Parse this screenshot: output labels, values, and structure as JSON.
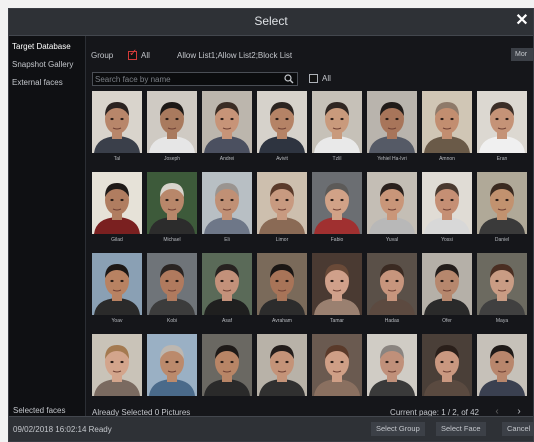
{
  "dialog": {
    "title": "Select",
    "close_label": "✕"
  },
  "sidebar": {
    "items": [
      {
        "label": "Target Database",
        "active": true
      },
      {
        "label": "Snapshot Gallery",
        "active": false
      },
      {
        "label": "External faces",
        "active": false
      }
    ],
    "bottom_label": "Selected faces"
  },
  "toolbar": {
    "group_label": "Group",
    "all_label": "All",
    "lists_label": "Allow List1;Allow List2;Block List",
    "more_label": "Mor"
  },
  "search": {
    "placeholder": "Search face by name",
    "value": "",
    "all_label": "All"
  },
  "faces": [
    {
      "name": "Tal",
      "tone": "#b8866a",
      "hair": "#2a2220",
      "bg": "#d9d4cc",
      "shirt": "#3a3f4a"
    },
    {
      "name": "Joseph",
      "tone": "#a97a5e",
      "hair": "#1c1816",
      "bg": "#cfcac3",
      "shirt": "#e6e6e6"
    },
    {
      "name": "Andrei",
      "tone": "#c79478",
      "hair": "#3a2c24",
      "bg": "#bcb6ad",
      "shirt": "#4b5060"
    },
    {
      "name": "Avivit",
      "tone": "#b58366",
      "hair": "#2b2421",
      "bg": "#d6d2cb",
      "shirt": "#2e3440"
    },
    {
      "name": "Tzlil",
      "tone": "#c99a7c",
      "hair": "#2f2622",
      "bg": "#c6c1b8",
      "shirt": "#e9e9e9"
    },
    {
      "name": "Yehiel Ha-Ivri",
      "tone": "#a8755a",
      "hair": "#201b19",
      "bg": "#b9b4ad",
      "shirt": "#555a66"
    },
    {
      "name": "Amnon",
      "tone": "#c28e70",
      "hair": "#8e7a6a",
      "bg": "#d0c6b5",
      "shirt": "#6a5a48"
    },
    {
      "name": "Eran",
      "tone": "#c59377",
      "hair": "#3b2e27",
      "bg": "#dcd8d1",
      "shirt": "#f0f0f0"
    },
    {
      "name": "Gilad",
      "tone": "#b07d60",
      "hair": "#1f1a18",
      "bg": "#e6e2d8",
      "shirt": "#7a2020"
    },
    {
      "name": "Michael",
      "tone": "#b8876a",
      "hair": "#d8d4cc",
      "bg": "#3d5a3a",
      "shirt": "#2c2c2c"
    },
    {
      "name": "Eli",
      "tone": "#c09075",
      "hair": "#9a9490",
      "bg": "#b8bfc4",
      "shirt": "#6e7788"
    },
    {
      "name": "Limor",
      "tone": "#c89a80",
      "hair": "#5a3a2a",
      "bg": "#cdbfae",
      "shirt": "#8a6a55"
    },
    {
      "name": "Fabio",
      "tone": "#d1a287",
      "hair": "#5c5a58",
      "bg": "#6b6e72",
      "shirt": "#a03030"
    },
    {
      "name": "Yuval",
      "tone": "#c99679",
      "hair": "#2a211d",
      "bg": "#c4beb5",
      "shirt": "#b8b8b8"
    },
    {
      "name": "Yossi",
      "tone": "#c58f74",
      "hair": "#4a3a30",
      "bg": "#e0dcd5",
      "shirt": "#d8d8d8"
    },
    {
      "name": "Daniel",
      "tone": "#c2926f",
      "hair": "#3a2a20",
      "bg": "#b0a998",
      "shirt": "#3a3a3a"
    },
    {
      "name": "Yoav",
      "tone": "#b88262",
      "hair": "#1d1816",
      "bg": "#8aa0b4",
      "shirt": "#2a2a2a"
    },
    {
      "name": "Kobi",
      "tone": "#b07a5e",
      "hair": "#2a2422",
      "bg": "#6f7479",
      "shirt": "#3c3c3c"
    },
    {
      "name": "Asaf",
      "tone": "#c3917a",
      "hair": "#272220",
      "bg": "#5a6a58",
      "shirt": "#1f1f1f"
    },
    {
      "name": "Avraham",
      "tone": "#a87458",
      "hair": "#1a1614",
      "bg": "#7a6a5a",
      "shirt": "#2c2c2c"
    },
    {
      "name": "Tamar",
      "tone": "#d0a08a",
      "hair": "#6a4a38",
      "bg": "#4a3a32",
      "shirt": "#9a8070"
    },
    {
      "name": "Hadas",
      "tone": "#c7957d",
      "hair": "#3a2a22",
      "bg": "#5a5048",
      "shirt": "#5c4a40"
    },
    {
      "name": "Ofer",
      "tone": "#b6876d",
      "hair": "#231d1b",
      "bg": "#b5b0a8",
      "shirt": "#2a2a2a"
    },
    {
      "name": "Maya",
      "tone": "#c99c84",
      "hair": "#4a2e22",
      "bg": "#6c6a60",
      "shirt": "#404040"
    },
    {
      "name": "",
      "tone": "#d3a58c",
      "hair": "#a47a50",
      "bg": "#c9c3b8",
      "shirt": "#7a6a60"
    },
    {
      "name": "",
      "tone": "#bb8a6c",
      "hair": "#bdb7b0",
      "bg": "#9ab0c4",
      "shirt": "#4a6a8a"
    },
    {
      "name": "",
      "tone": "#b88566",
      "hair": "#1e1a18",
      "bg": "#6a6862",
      "shirt": "#2a2a2a"
    },
    {
      "name": "",
      "tone": "#c49378",
      "hair": "#231d1b",
      "bg": "#b8b2a8",
      "shirt": "#303030"
    },
    {
      "name": "",
      "tone": "#cf9f86",
      "hair": "#5a3a2a",
      "bg": "#6a5a50",
      "shirt": "#8a7060"
    },
    {
      "name": "",
      "tone": "#c0907a",
      "hair": "#8a8480",
      "bg": "#d0ccc5",
      "shirt": "#3a3a3a"
    },
    {
      "name": "",
      "tone": "#ca9880",
      "hair": "#2a1f1a",
      "bg": "#4a3f38",
      "shirt": "#5a4a40"
    },
    {
      "name": "",
      "tone": "#b8866c",
      "hair": "#1f1a18",
      "bg": "#c6c1b9",
      "shirt": "#3a4050"
    }
  ],
  "status": {
    "selected_text": "Already Selected 0 Pictures",
    "page_text": "Current page: 1 / 2, of 42"
  },
  "pager": {
    "prev": "‹",
    "next": "›"
  },
  "footer": {
    "status": "09/02/2018 16:02:14 Ready",
    "select_group": "Select Group",
    "select_face": "Select Face",
    "cancel": "Cancel"
  }
}
